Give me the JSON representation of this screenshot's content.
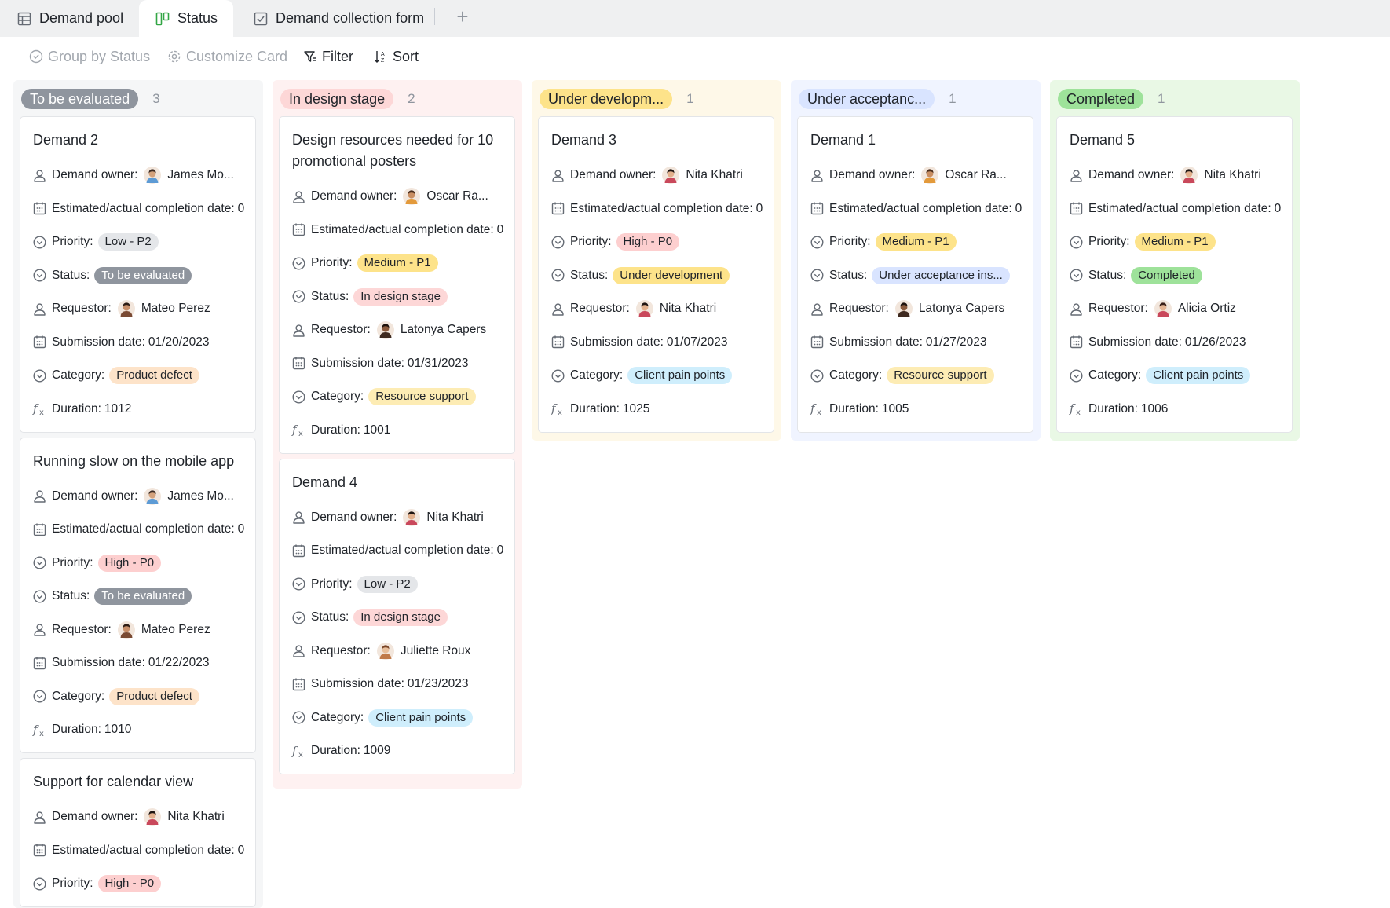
{
  "tabs": [
    {
      "label": "Demand pool",
      "icon": "table-icon",
      "active": false
    },
    {
      "label": "Status",
      "icon": "kanban-icon",
      "active": true
    },
    {
      "label": "Demand collection form",
      "icon": "form-icon",
      "active": false
    }
  ],
  "add_tab_label": "+",
  "toolbar": {
    "group_label": "Group by Status",
    "customize_label": "Customize Card",
    "filter_label": "Filter",
    "sort_label": "Sort"
  },
  "field_labels": {
    "owner": "Demand owner:",
    "date_est": "Estimated/actual completion date:",
    "priority": "Priority:",
    "status": "Status:",
    "requestor": "Requestor:",
    "submission": "Submission date:",
    "category": "Category:",
    "duration": "Duration:"
  },
  "colors": {
    "col_gray_bg": "#f5f6f7",
    "col_red_bg": "#fef1f1",
    "col_yellow_bg": "#fef8e8",
    "col_blue_bg": "#f0f4ff",
    "col_green_bg": "#e9f8e5",
    "pill_gray": "#8f959e",
    "pill_red": "#fdd7d7",
    "pill_yellow": "#fde38a",
    "pill_blue": "#d9e4ff",
    "pill_green": "#9ee29a",
    "tag_low": "#e4e6e9",
    "tag_high": "#fdcfcf",
    "tag_medium": "#fde38a",
    "tag_product_defect": "#fde3c9",
    "tag_resource_support": "#fdecb4",
    "tag_client_pain": "#cfeefc",
    "active_tab_icon": "#32a645"
  },
  "columns": [
    {
      "name": "To be evaluated",
      "count": "3",
      "cards": [
        {
          "title": "Demand 2",
          "owner": "James Mo...",
          "date_est": "0",
          "priority": "Low - P2",
          "status": "To be evaluated",
          "requestor": "Mateo Perez",
          "submission": "01/20/2023",
          "category": "Product defect",
          "duration": "1012"
        },
        {
          "title": "Running slow on the mobile app",
          "owner": "James Mo...",
          "date_est": "0",
          "priority": "High - P0",
          "status": "To be evaluated",
          "requestor": "Mateo Perez",
          "submission": "01/22/2023",
          "category": "Product defect",
          "duration": "1010"
        },
        {
          "title": "Support for calendar view",
          "owner": "Nita Khatri",
          "date_est": "0",
          "priority": "High - P0"
        }
      ]
    },
    {
      "name": "In design stage",
      "count": "2",
      "cards": [
        {
          "title": "Design resources needed for 10 promotional posters",
          "owner": "Oscar Ra...",
          "date_est": "0",
          "priority": "Medium - P1",
          "status": "In design stage",
          "requestor": "Latonya Capers",
          "submission": "01/31/2023",
          "category": "Resource support",
          "duration": "1001"
        },
        {
          "title": "Demand 4",
          "owner": "Nita Khatri",
          "date_est": "0",
          "priority": "Low - P2",
          "status": "In design stage",
          "requestor": "Juliette Roux",
          "submission": "01/23/2023",
          "category": "Client pain points",
          "duration": "1009"
        }
      ]
    },
    {
      "name": "Under developm...",
      "count": "1",
      "cards": [
        {
          "title": "Demand 3",
          "owner": "Nita Khatri",
          "date_est": "0",
          "priority": "High - P0",
          "status": "Under development",
          "requestor": "Nita Khatri",
          "submission": "01/07/2023",
          "category": "Client pain points",
          "duration": "1025"
        }
      ]
    },
    {
      "name": "Under acceptanc...",
      "count": "1",
      "cards": [
        {
          "title": "Demand 1",
          "owner": "Oscar Ra...",
          "date_est": "0",
          "priority": "Medium - P1",
          "status": "Under acceptance ins...",
          "requestor": "Latonya Capers",
          "submission": "01/27/2023",
          "category": "Resource support",
          "duration": "1005"
        }
      ]
    },
    {
      "name": "Completed",
      "count": "1",
      "cards": [
        {
          "title": "Demand 5",
          "owner": "Nita Khatri",
          "date_est": "0",
          "priority": "Medium - P1",
          "status": "Completed",
          "requestor": "Alicia Ortiz",
          "submission": "01/26/2023",
          "category": "Client pain points",
          "duration": "1006"
        }
      ]
    }
  ]
}
